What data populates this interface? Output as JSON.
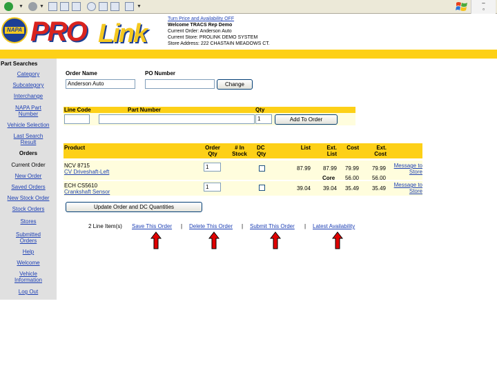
{
  "header": {
    "turn_price_link": "Turn Price and Availability OFF",
    "welcome": "Welcome TRACS Rep Demo",
    "current_order": "Current Order: Anderson Auto",
    "current_store": "Current Store: PROLINK DEMO SYSTEM",
    "store_address": "Store Address: 222 CHASTAIN MEADOWS CT.",
    "logo_napa": "NAPA",
    "logo_pro": "PRO",
    "logo_link": "Link"
  },
  "sidebar": {
    "title": "Part Searches",
    "items": [
      {
        "label": "Category"
      },
      {
        "label": "Subcategory"
      },
      {
        "label": "Interchange"
      },
      {
        "label": "NAPA Part Number"
      },
      {
        "label": "Vehicle Selection"
      },
      {
        "label": "Last Search Result"
      },
      {
        "label": "Orders"
      },
      {
        "label": "Current Order"
      },
      {
        "label": "New Order"
      },
      {
        "label": "Saved Orders"
      },
      {
        "label": "New Stock Order"
      },
      {
        "label": "Stock Orders"
      },
      {
        "label": "Stores"
      },
      {
        "label": "Submitted Orders"
      },
      {
        "label": "Help"
      },
      {
        "label": "Welcome"
      },
      {
        "label": "Vehicle Information"
      },
      {
        "label": "Log Out"
      }
    ]
  },
  "order_form": {
    "order_name_label": "Order Name",
    "order_name_value": "Anderson Auto",
    "po_number_label": "PO Number",
    "po_number_value": "",
    "change_button": "Change"
  },
  "add_line": {
    "line_code_label": "Line Code",
    "part_number_label": "Part Number",
    "qty_label": "Qty",
    "line_code_value": "",
    "part_number_value": "",
    "qty_value": "1",
    "add_button": "Add To Order"
  },
  "table": {
    "headers": {
      "product": "Product",
      "order_qty": "Order Qty",
      "in_stock": "# In Stock",
      "dc_qty": "DC Qty",
      "list": "List",
      "ext_list": "Ext. List",
      "cost": "Cost",
      "ext_cost": "Ext. Cost"
    },
    "rows": [
      {
        "code": "NCV 8715",
        "desc": "CV Driveshaft-Left",
        "qty": "1",
        "list": "87.99",
        "ext_list": "87.99",
        "cost": "79.99",
        "ext_cost": "79.99",
        "msg": "Message to Store",
        "core_label": "Core",
        "core_cost": "56.00",
        "core_ext_cost": "56.00"
      },
      {
        "code": "ECH CS5610",
        "desc": "Crankshaft Sensor",
        "qty": "1",
        "list": "39.04",
        "ext_list": "39.04",
        "cost": "35.49",
        "ext_cost": "35.49",
        "msg": "Message to Store"
      }
    ]
  },
  "update_button": "Update Order and DC Quantities",
  "footer": {
    "count": "2 Line Item(s)",
    "save": "Save This Order",
    "delete": "Delete This Order",
    "submit": "Submit This Order",
    "availability": "Latest Availability",
    "sep": "|"
  },
  "colors": {
    "accent_yellow": "#fdd017",
    "link_blue": "#1c3fb4",
    "arrow_red": "#e00000",
    "sidebar_bg": "#e0e0e0"
  }
}
